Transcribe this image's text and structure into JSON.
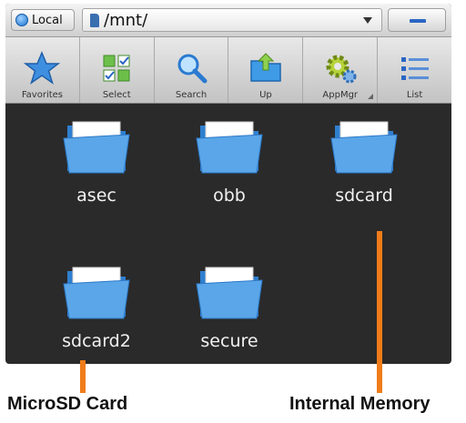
{
  "topbar": {
    "local_label": "Local",
    "path": "/mnt/"
  },
  "toolbar": {
    "items": [
      {
        "label": "Favorites",
        "icon": "star-icon"
      },
      {
        "label": "Select",
        "icon": "select-grid-icon"
      },
      {
        "label": "Search",
        "icon": "magnifier-icon"
      },
      {
        "label": "Up",
        "icon": "folder-up-icon"
      },
      {
        "label": "AppMgr",
        "icon": "gear-icon"
      },
      {
        "label": "List",
        "icon": "list-icon"
      }
    ]
  },
  "folders": [
    {
      "name": "asec"
    },
    {
      "name": "obb"
    },
    {
      "name": "sdcard"
    },
    {
      "name": "sdcard2"
    },
    {
      "name": "secure"
    }
  ],
  "annotations": {
    "microsd": "MicroSD Card",
    "internal": "Internal Memory"
  },
  "colors": {
    "annotation": "#f07c1a",
    "background": "#2a2a2a",
    "folder": "#5aa6e8"
  }
}
